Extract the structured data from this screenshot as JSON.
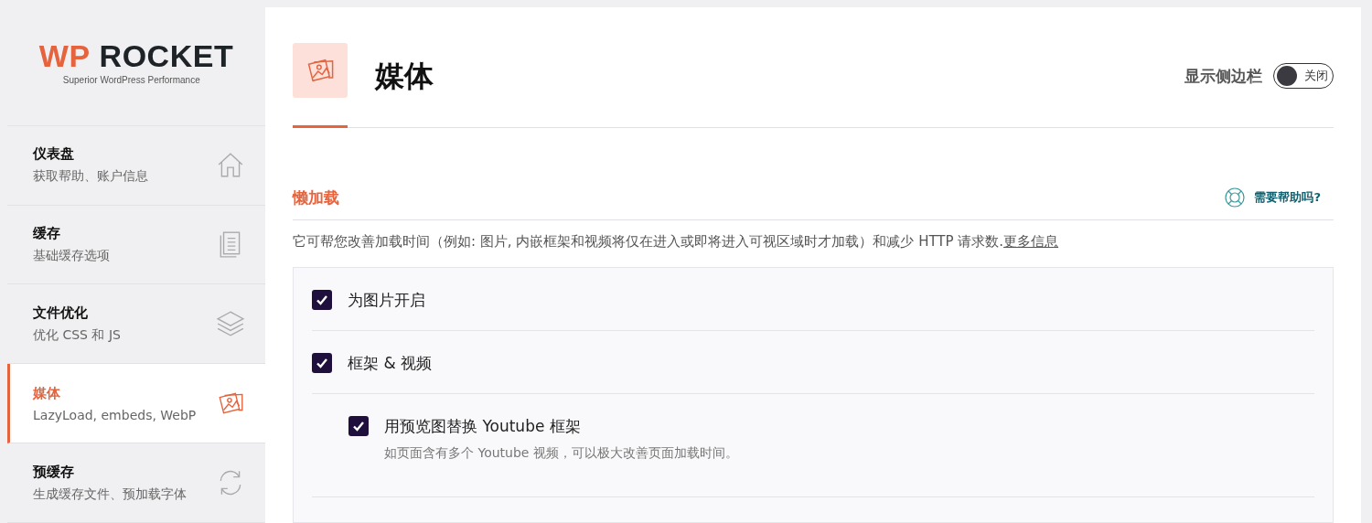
{
  "logo": {
    "mark": "WP",
    "name": "ROCKET",
    "tagline": "Superior WordPress Performance"
  },
  "sidebar": {
    "items": [
      {
        "title": "仪表盘",
        "subtitle": "获取帮助、账户信息",
        "selected": false
      },
      {
        "title": "缓存",
        "subtitle": "基础缓存选项",
        "selected": false
      },
      {
        "title": "文件优化",
        "subtitle": "优化 CSS 和 JS",
        "selected": false
      },
      {
        "title": "媒体",
        "subtitle": "LazyLoad, embeds, WebP",
        "selected": true
      },
      {
        "title": "预缓存",
        "subtitle": "生成缓存文件、预加载字体",
        "selected": false
      }
    ]
  },
  "header": {
    "title": "媒体",
    "sidebar_toggle": {
      "label": "显示侧边栏",
      "state_label": "关闭",
      "on": false
    }
  },
  "section": {
    "title": "懒加载",
    "help_link": "需要帮助吗?",
    "description": "它可帮您改善加载时间（例如: 图片, 内嵌框架和视频将仅在进入或即将进入可视区域时才加载）和减少 HTTP 请求数.",
    "more_link": "更多信息",
    "options": [
      {
        "label": "为图片开启",
        "checked": true
      },
      {
        "label": "框架 & 视频",
        "checked": true,
        "children": [
          {
            "label": "用预览图替换 Youtube 框架",
            "description": "如页面含有多个 Youtube 视频，可以极大改善页面加载时间。",
            "checked": true
          }
        ]
      }
    ]
  }
}
